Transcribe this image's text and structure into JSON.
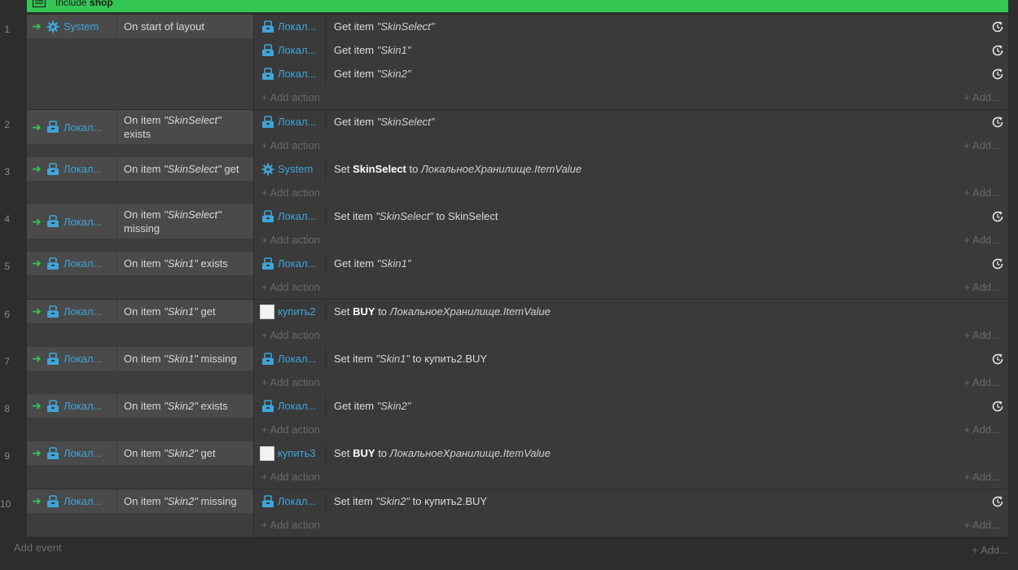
{
  "include": {
    "label": "Include",
    "name": "shop"
  },
  "icons": {
    "storage": "storage-icon",
    "system": "gear-icon",
    "sprite": "sprite-icon",
    "reset": "reset-icon",
    "include": "include-icon",
    "arrow": "trigger-arrow-icon"
  },
  "colors": {
    "include_bar": "#33c653",
    "object_link": "#3fa4d8",
    "trigger_arrow": "#33c653"
  },
  "labels": {
    "add_action": "+ Add action",
    "add_dots": "+ Add...",
    "add_event": "Add event",
    "add_event_right": "+ Add..."
  },
  "events": [
    {
      "num": "1",
      "cond": {
        "obj": "System",
        "icon": "gear-icon",
        "text": "On start of layout"
      },
      "actions": [
        {
          "obj": "Локал...",
          "icon": "storage-icon",
          "pre": "Get item ",
          "item": "\"SkinSelect\"",
          "post": "",
          "reset": true
        },
        {
          "obj": "Локал...",
          "icon": "storage-icon",
          "pre": "Get item ",
          "item": "\"Skin1\"",
          "post": "",
          "reset": true
        },
        {
          "obj": "Локал...",
          "icon": "storage-icon",
          "pre": "Get item ",
          "item": "\"Skin2\"",
          "post": "",
          "reset": true
        }
      ]
    },
    {
      "num": "2",
      "cond": {
        "obj": "Локал...",
        "icon": "storage-icon",
        "pre": "On item ",
        "item": "\"SkinSelect\"",
        "post": " exists"
      },
      "actions": [
        {
          "obj": "Локал...",
          "icon": "storage-icon",
          "pre": "Get item ",
          "item": "\"SkinSelect\"",
          "post": "",
          "reset": true
        }
      ]
    },
    {
      "num": "3",
      "cond": {
        "obj": "Локал...",
        "icon": "storage-icon",
        "pre": "On item ",
        "item": "\"SkinSelect\"",
        "post": " get"
      },
      "actions": [
        {
          "obj": "System",
          "icon": "gear-icon",
          "pre": "Set ",
          "bold": "SkinSelect",
          "mid": " to ",
          "italic": "ЛокальноеХранилище.ItemValue",
          "reset": false
        }
      ]
    },
    {
      "num": "4",
      "cond": {
        "obj": "Локал...",
        "icon": "storage-icon",
        "pre": "On item ",
        "item": "\"SkinSelect\"",
        "post": " missing"
      },
      "actions": [
        {
          "obj": "Локал...",
          "icon": "storage-icon",
          "pre": "Set item ",
          "item": "\"SkinSelect\"",
          "post": " to SkinSelect",
          "reset": true
        }
      ]
    },
    {
      "num": "5",
      "cond": {
        "obj": "Локал...",
        "icon": "storage-icon",
        "pre": "On item ",
        "item": "\"Skin1\"",
        "post": " exists"
      },
      "actions": [
        {
          "obj": "Локал...",
          "icon": "storage-icon",
          "pre": "Get item ",
          "item": "\"Skin1\"",
          "post": "",
          "reset": true
        }
      ]
    },
    {
      "num": "6",
      "cond": {
        "obj": "Локал...",
        "icon": "storage-icon",
        "pre": "On item ",
        "item": "\"Skin1\"",
        "post": " get"
      },
      "actions": [
        {
          "obj": "купить2",
          "icon": "sprite-icon",
          "pre": "Set ",
          "bold": "BUY",
          "mid": " to ",
          "italic": "ЛокальноеХранилище.ItemValue",
          "reset": false
        }
      ]
    },
    {
      "num": "7",
      "cond": {
        "obj": "Локал...",
        "icon": "storage-icon",
        "pre": "On item ",
        "item": "\"Skin1\"",
        "post": " missing"
      },
      "actions": [
        {
          "obj": "Локал...",
          "icon": "storage-icon",
          "pre": "Set item ",
          "item": "\"Skin1\"",
          "post": " to купить2.BUY",
          "reset": true
        }
      ]
    },
    {
      "num": "8",
      "cond": {
        "obj": "Локал...",
        "icon": "storage-icon",
        "pre": "On item ",
        "item": "\"Skin2\"",
        "post": " exists"
      },
      "actions": [
        {
          "obj": "Локал...",
          "icon": "storage-icon",
          "pre": "Get item ",
          "item": "\"Skin2\"",
          "post": "",
          "reset": true
        }
      ]
    },
    {
      "num": "9",
      "cond": {
        "obj": "Локал...",
        "icon": "storage-icon",
        "pre": "On item ",
        "item": "\"Skin2\"",
        "post": " get"
      },
      "actions": [
        {
          "obj": "купить3",
          "icon": "sprite-icon",
          "pre": "Set ",
          "bold": "BUY",
          "mid": " to ",
          "italic": "ЛокальноеХранилище.ItemValue",
          "reset": false
        }
      ]
    },
    {
      "num": "10",
      "cond": {
        "obj": "Локал...",
        "icon": "storage-icon",
        "pre": "On item ",
        "item": "\"Skin2\"",
        "post": " missing"
      },
      "actions": [
        {
          "obj": "Локал...",
          "icon": "storage-icon",
          "pre": "Set item ",
          "item": "\"Skin2\"",
          "post": " to купить2.BUY",
          "reset": true
        }
      ]
    }
  ]
}
